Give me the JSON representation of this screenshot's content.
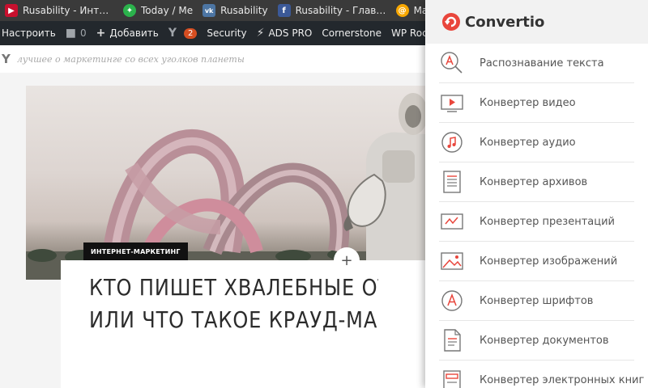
{
  "colors": {
    "accent": "#e9463c",
    "admin_bar": "#23282d",
    "bookmarks_bar": "#3a3a3a",
    "badge": "#d54e21"
  },
  "bookmarks": [
    {
      "label": "Rusability - Интерне",
      "icon": "rusability-favicon"
    },
    {
      "label": "Today / Me",
      "icon": "feedly-favicon"
    },
    {
      "label": "Rusability",
      "icon": "vk-favicon"
    },
    {
      "label": "Rusability - Главная",
      "icon": "facebook-favicon"
    },
    {
      "label": "Mail.Ru",
      "icon": "mail-ru-favicon"
    }
  ],
  "admin_bar": {
    "customize": "Настроить",
    "comments_count": "0",
    "add_new": "Добавить",
    "yoast_count": "2",
    "security": "Security",
    "ads_pro": "ADS PRO",
    "cornerstone": "Cornerstone",
    "wp_rocket": "WP Rocket"
  },
  "site": {
    "logo_fragment": "Y",
    "tagline": "лучшее о маркетинге со всех уголков планеты"
  },
  "article": {
    "category": "ИНТЕРНЕТ-МАРКЕТИНГ",
    "plus": "+",
    "title_line1": "КТО ПИШЕТ ХВАЛЕБНЫЕ ОТЗЫВЫ",
    "title_line2": "ИЛИ ЧТО ТАКОЕ КРАУД-МАРКЕТИНГ"
  },
  "panel": {
    "brand": "Convertio",
    "items": [
      {
        "label": "Распознавание текста",
        "icon": "ocr-icon"
      },
      {
        "label": "Конвертер видео",
        "icon": "video-icon"
      },
      {
        "label": "Конвертер аудио",
        "icon": "audio-icon"
      },
      {
        "label": "Конвертер архивов",
        "icon": "archive-icon"
      },
      {
        "label": "Конвертер презентаций",
        "icon": "presentation-icon"
      },
      {
        "label": "Конвертер изображений",
        "icon": "image-icon"
      },
      {
        "label": "Конвертер шрифтов",
        "icon": "font-icon"
      },
      {
        "label": "Конвертер документов",
        "icon": "document-icon"
      },
      {
        "label": "Конвертер электронных книг",
        "icon": "ebook-icon"
      }
    ]
  }
}
